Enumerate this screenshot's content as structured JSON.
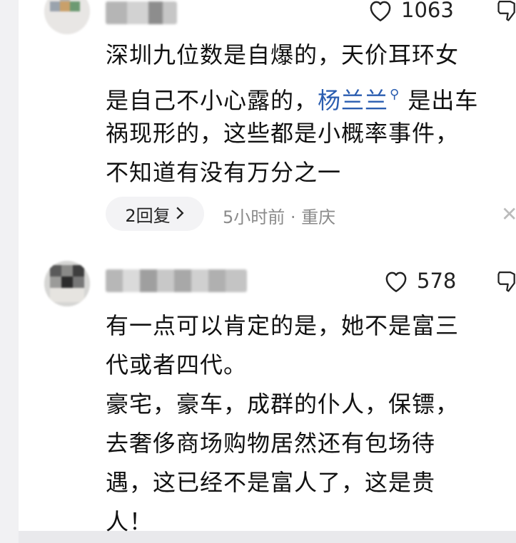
{
  "comments": [
    {
      "likes": "1063",
      "lines": [
        "深圳九位数是自爆的，天价耳环女",
        "是自己不小心露的，",
        "祸现形的，这些都是小概率事件，",
        "不知道有没有万分之一"
      ],
      "mention": "杨兰兰",
      "after_mention": " 是出车",
      "reply_label": "2回复",
      "meta": "5小时前 · 重庆"
    },
    {
      "likes": "578",
      "lines": [
        "有一点可以肯定的是，她不是富三",
        "代或者四代。",
        "豪宅，豪车，成群的仆人，保镖，",
        "去奢侈商场购物居然还有包场待",
        "遇，这已经不是富人了，这是贵",
        "人！"
      ]
    }
  ],
  "icons": {
    "like": "heart-outline-icon",
    "dislike": "thumbs-down-icon",
    "search": "search-icon",
    "reply_arrow": "chevron-right-icon",
    "close": "close-icon"
  },
  "colors": {
    "mention": "#2a5db0",
    "meta": "#8a8a8a",
    "background": "#ffffff"
  }
}
